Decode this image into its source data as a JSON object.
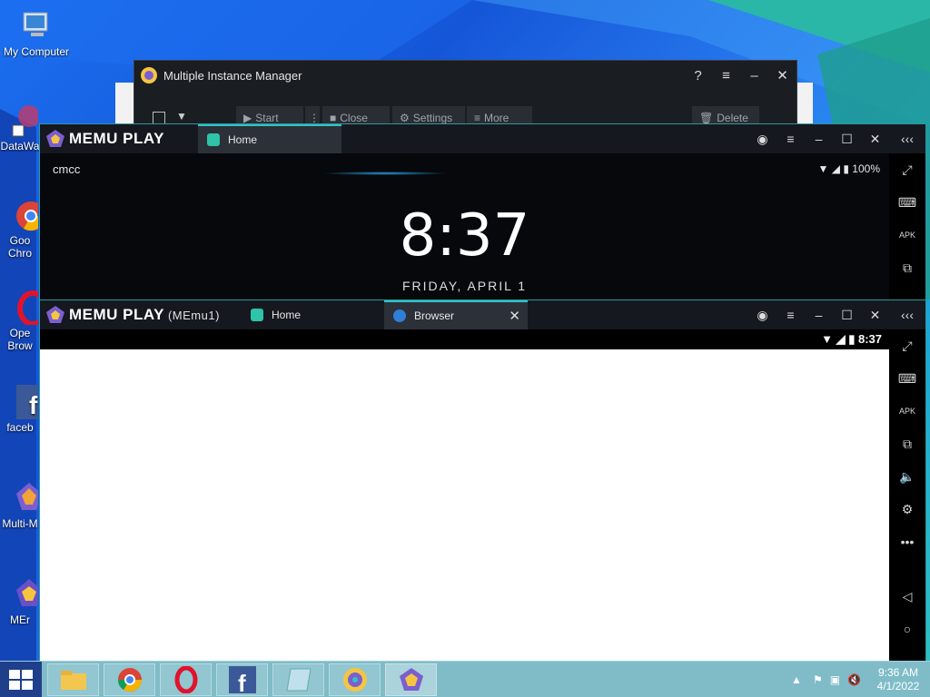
{
  "desktop": {
    "icons": [
      {
        "name": "my-computer",
        "label": "My Computer"
      },
      {
        "name": "datawave",
        "label": "DataWa"
      },
      {
        "name": "google-chrome",
        "label": "Goo\nChro"
      },
      {
        "name": "opera-browser",
        "label": "Ope\nBrow"
      },
      {
        "name": "facebook",
        "label": "faceb"
      },
      {
        "name": "multi-memu",
        "label": "Multi-M"
      },
      {
        "name": "memu",
        "label": "MEr"
      }
    ]
  },
  "manager": {
    "title": "Multiple Instance Manager",
    "toolbar": {
      "start": "Start",
      "close": "Close",
      "settings": "Settings",
      "more": "More",
      "delete": "Delete"
    }
  },
  "memu_main": {
    "brand": "MEMU PLAY",
    "tabs": [
      {
        "label": "Home"
      }
    ],
    "carrier": "cmcc",
    "battery": "100%",
    "clock": "8:37",
    "date": "FRIDAY, APRIL 1"
  },
  "memu_1": {
    "brand": "MEMU PLAY",
    "instance": "(MEmu1)",
    "tabs": [
      {
        "label": "Home"
      },
      {
        "label": "Browser"
      }
    ],
    "status_time": "8:37"
  },
  "taskbar": {
    "time": "9:36 AM",
    "date": "4/1/2022"
  }
}
